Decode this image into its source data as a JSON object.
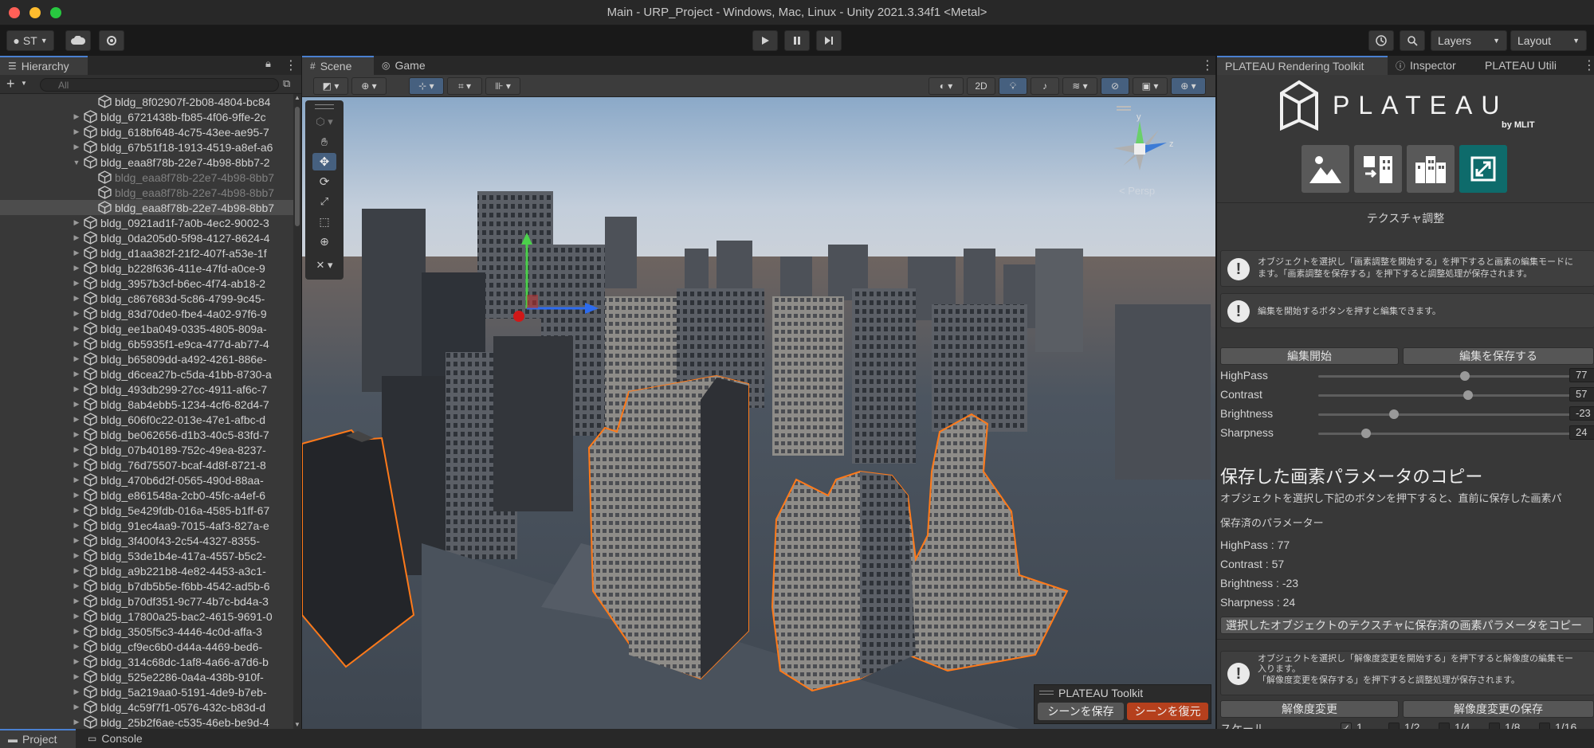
{
  "window": {
    "title": "Main - URP_Project - Windows, Mac, Linux - Unity 2021.3.34f1 <Metal>"
  },
  "toolbar": {
    "account": "ST",
    "layers": "Layers",
    "layout": "Layout"
  },
  "hierarchy": {
    "tab": "Hierarchy",
    "search_placeholder": "All",
    "rows": [
      {
        "label": "bldg_8f02907f-2b08-4804-bc84",
        "indent": 2,
        "arrow": "",
        "style": "normal"
      },
      {
        "label": "bldg_6721438b-fb85-4f06-9ffe-2c",
        "indent": 1,
        "arrow": "▶",
        "style": "normal"
      },
      {
        "label": "bldg_618bf648-4c75-43ee-ae95-7",
        "indent": 1,
        "arrow": "▶",
        "style": "normal"
      },
      {
        "label": "bldg_67b51f18-1913-4519-a8ef-a6",
        "indent": 1,
        "arrow": "▶",
        "style": "normal"
      },
      {
        "label": "bldg_eaa8f78b-22e7-4b98-8bb7-2",
        "indent": 1,
        "arrow": "▼",
        "style": "normal"
      },
      {
        "label": "bldg_eaa8f78b-22e7-4b98-8bb7",
        "indent": 2,
        "arrow": "",
        "style": "dim"
      },
      {
        "label": "bldg_eaa8f78b-22e7-4b98-8bb7",
        "indent": 2,
        "arrow": "",
        "style": "dim"
      },
      {
        "label": "bldg_eaa8f78b-22e7-4b98-8bb7",
        "indent": 2,
        "arrow": "",
        "style": "sel"
      },
      {
        "label": "bldg_0921ad1f-7a0b-4ec2-9002-3",
        "indent": 1,
        "arrow": "▶",
        "style": "normal"
      },
      {
        "label": "bldg_0da205d0-5f98-4127-8624-4",
        "indent": 1,
        "arrow": "▶",
        "style": "normal"
      },
      {
        "label": "bldg_d1aa382f-21f2-407f-a53e-1f",
        "indent": 1,
        "arrow": "▶",
        "style": "normal"
      },
      {
        "label": "bldg_b228f636-411e-47fd-a0ce-9",
        "indent": 1,
        "arrow": "▶",
        "style": "normal"
      },
      {
        "label": "bldg_3957b3cf-b6ec-4f74-ab18-2",
        "indent": 1,
        "arrow": "▶",
        "style": "normal"
      },
      {
        "label": "bldg_c867683d-5c86-4799-9c45-",
        "indent": 1,
        "arrow": "▶",
        "style": "normal"
      },
      {
        "label": "bldg_83d70de0-fbe4-4a02-97f6-9",
        "indent": 1,
        "arrow": "▶",
        "style": "normal"
      },
      {
        "label": "bldg_ee1ba049-0335-4805-809a-",
        "indent": 1,
        "arrow": "▶",
        "style": "normal"
      },
      {
        "label": "bldg_6b5935f1-e9ca-477d-ab77-4",
        "indent": 1,
        "arrow": "▶",
        "style": "normal"
      },
      {
        "label": "bldg_b65809dd-a492-4261-886e-",
        "indent": 1,
        "arrow": "▶",
        "style": "normal"
      },
      {
        "label": "bldg_d6cea27b-c5da-41bb-8730-a",
        "indent": 1,
        "arrow": "▶",
        "style": "normal"
      },
      {
        "label": "bldg_493db299-27cc-4911-af6c-7",
        "indent": 1,
        "arrow": "▶",
        "style": "normal"
      },
      {
        "label": "bldg_8ab4ebb5-1234-4cf6-82d4-7",
        "indent": 1,
        "arrow": "▶",
        "style": "normal"
      },
      {
        "label": "bldg_606f0c22-013e-47e1-afbc-d",
        "indent": 1,
        "arrow": "▶",
        "style": "normal"
      },
      {
        "label": "bldg_be062656-d1b3-40c5-83fd-7",
        "indent": 1,
        "arrow": "▶",
        "style": "normal"
      },
      {
        "label": "bldg_07b40189-752c-49ea-8237-",
        "indent": 1,
        "arrow": "▶",
        "style": "normal"
      },
      {
        "label": "bldg_76d75507-bcaf-4d8f-8721-8",
        "indent": 1,
        "arrow": "▶",
        "style": "normal"
      },
      {
        "label": "bldg_470b6d2f-0565-490d-88aa-",
        "indent": 1,
        "arrow": "▶",
        "style": "normal"
      },
      {
        "label": "bldg_e861548a-2cb0-45fc-a4ef-6",
        "indent": 1,
        "arrow": "▶",
        "style": "normal"
      },
      {
        "label": "bldg_5e429fdb-016a-4585-b1ff-67",
        "indent": 1,
        "arrow": "▶",
        "style": "normal"
      },
      {
        "label": "bldg_91ec4aa9-7015-4af3-827a-e",
        "indent": 1,
        "arrow": "▶",
        "style": "normal"
      },
      {
        "label": "bldg_3f400f43-2c54-4327-8355-",
        "indent": 1,
        "arrow": "▶",
        "style": "normal"
      },
      {
        "label": "bldg_53de1b4e-417a-4557-b5c2-",
        "indent": 1,
        "arrow": "▶",
        "style": "normal"
      },
      {
        "label": "bldg_a9b221b8-4e82-4453-a3c1-",
        "indent": 1,
        "arrow": "▶",
        "style": "normal"
      },
      {
        "label": "bldg_b7db5b5e-f6bb-4542-ad5b-6",
        "indent": 1,
        "arrow": "▶",
        "style": "normal"
      },
      {
        "label": "bldg_b70df351-9c77-4b7c-bd4a-3",
        "indent": 1,
        "arrow": "▶",
        "style": "normal"
      },
      {
        "label": "bldg_17800a25-bac2-4615-9691-0",
        "indent": 1,
        "arrow": "▶",
        "style": "normal"
      },
      {
        "label": "bldg_3505f5c3-4446-4c0d-affa-3",
        "indent": 1,
        "arrow": "▶",
        "style": "normal"
      },
      {
        "label": "bldg_cf9ec6b0-d44a-4469-bed6-",
        "indent": 1,
        "arrow": "▶",
        "style": "normal"
      },
      {
        "label": "bldg_314c68dc-1af8-4a66-a7d6-b",
        "indent": 1,
        "arrow": "▶",
        "style": "normal"
      },
      {
        "label": "bldg_525e2286-0a4a-438b-910f-",
        "indent": 1,
        "arrow": "▶",
        "style": "normal"
      },
      {
        "label": "bldg_5a219aa0-5191-4de9-b7eb-",
        "indent": 1,
        "arrow": "▶",
        "style": "normal"
      },
      {
        "label": "bldg_4c59f7f1-0576-432c-b83d-d",
        "indent": 1,
        "arrow": "▶",
        "style": "normal"
      },
      {
        "label": "bldg_25b2f6ae-c535-46eb-be9d-4",
        "indent": 1,
        "arrow": "▶",
        "style": "normal"
      }
    ]
  },
  "bottom_tabs": {
    "project": "Project",
    "console": "Console"
  },
  "scene": {
    "tab_scene": "Scene",
    "tab_game": "Game",
    "btn_2d": "2D",
    "persp_label": "< Persp",
    "axis_y": "y",
    "axis_z": "z",
    "toolkit": {
      "title": "PLATEAU Toolkit",
      "save": "シーンを保存",
      "restore": "シーンを復元"
    }
  },
  "right_panel": {
    "tabs": [
      "PLATEAU Rendering Toolkit",
      "Inspector",
      "PLATEAU Utili"
    ],
    "logo_text": "PLATEAU",
    "logo_sub": "by MLIT",
    "section_texture": "テクスチャ調整",
    "help1_line1": "オブジェクトを選択し「画素調整を開始する」を押下すると画素の編集モードに",
    "help1_line2": "ます。「画素調整を保存する」を押下すると調整処理が保存されます。",
    "help2": "編集を開始するボタンを押すと編集できます。",
    "btn_edit_start": "編集開始",
    "btn_edit_save": "編集を保存する",
    "sliders": [
      {
        "label": "HighPass",
        "value": 77,
        "pos": 0.58
      },
      {
        "label": "Contrast",
        "value": 57,
        "pos": 0.59
      },
      {
        "label": "Brightness",
        "value": -23,
        "pos": 0.3
      },
      {
        "label": "Sharpness",
        "value": 24,
        "pos": 0.19
      }
    ],
    "copy_heading": "保存した画素パラメータのコピー",
    "copy_desc": "オブジェクトを選択し下記のボタンを押下すると、直前に保存した画素パ",
    "saved_params_label": "保存済のパラメーター",
    "saved_params": [
      "HighPass : 77",
      "Contrast : 57",
      "Brightness : -23",
      "Sharpness : 24"
    ],
    "btn_copy": "選択したオブジェクトのテクスチャに保存済の画素パラメータをコピー",
    "help3_line1": "オブジェクトを選択し「解像度変更を開始する」を押下すると解像度の編集モー",
    "help3_line2": "入ります。",
    "help3_line3": "「解像度変更を保存する」を押下すると調整処理が保存されます。",
    "btn_res_change": "解像度変更",
    "btn_res_save": "解像度変更の保存",
    "scale_label": "スケール",
    "scale_options": [
      {
        "label": "1",
        "checked": true
      },
      {
        "label": "1/2",
        "checked": false
      },
      {
        "label": "1/4",
        "checked": false
      },
      {
        "label": "1/8",
        "checked": false
      },
      {
        "label": "1/16",
        "checked": false
      }
    ]
  },
  "colors": {
    "selection_outline": "#ff7a1a",
    "accent_blue": "#4a80d0",
    "restore_button": "#b5401d",
    "tile_active": "#0e6b6b"
  }
}
